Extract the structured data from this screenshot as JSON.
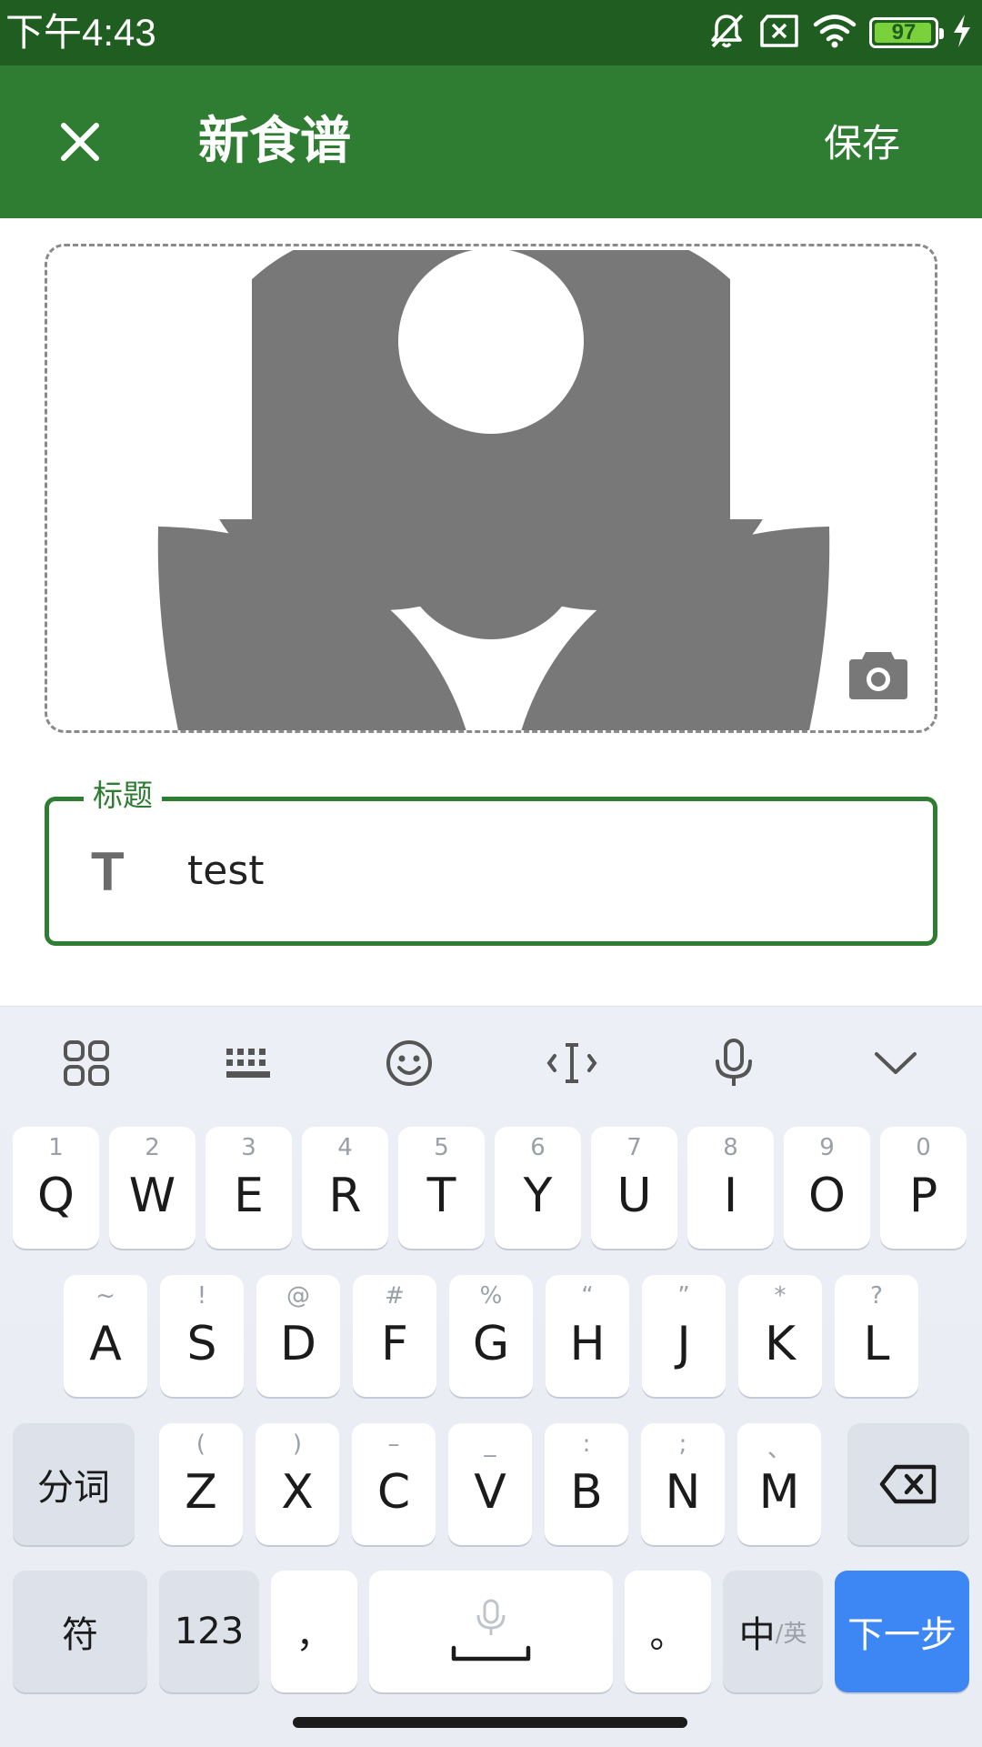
{
  "status_bar": {
    "time": "下午4:43",
    "battery": "97",
    "battery_level": 0.97,
    "icons": [
      "bell-off-icon",
      "sim-error-icon",
      "wifi-icon",
      "battery-icon",
      "charging-icon"
    ]
  },
  "app_bar": {
    "title": "新食谱",
    "save_label": "保存",
    "close_icon": "close-icon"
  },
  "image_picker": {
    "placeholder_icon": "flower-image-icon",
    "camera_icon": "camera-icon"
  },
  "title_field": {
    "label": "标题",
    "icon_text": "T",
    "value": "test"
  },
  "keyboard": {
    "toolbar": [
      "apps-grid-icon",
      "keyboard-icon",
      "emoji-icon",
      "cursor-move-icon",
      "microphone-icon",
      "chevron-down-icon"
    ],
    "row1": [
      {
        "hint": "1",
        "main": "Q"
      },
      {
        "hint": "2",
        "main": "W"
      },
      {
        "hint": "3",
        "main": "E"
      },
      {
        "hint": "4",
        "main": "R"
      },
      {
        "hint": "5",
        "main": "T"
      },
      {
        "hint": "6",
        "main": "Y"
      },
      {
        "hint": "7",
        "main": "U"
      },
      {
        "hint": "8",
        "main": "I"
      },
      {
        "hint": "9",
        "main": "O"
      },
      {
        "hint": "0",
        "main": "P"
      }
    ],
    "row2": [
      {
        "hint": "~",
        "main": "A"
      },
      {
        "hint": "!",
        "main": "S"
      },
      {
        "hint": "@",
        "main": "D"
      },
      {
        "hint": "#",
        "main": "F"
      },
      {
        "hint": "%",
        "main": "G"
      },
      {
        "hint": "“",
        "main": "H"
      },
      {
        "hint": "”",
        "main": "J"
      },
      {
        "hint": "*",
        "main": "K"
      },
      {
        "hint": "?",
        "main": "L"
      }
    ],
    "row3": [
      {
        "hint": "(",
        "main": "Z"
      },
      {
        "hint": ")",
        "main": "X"
      },
      {
        "hint": "–",
        "main": "C"
      },
      {
        "hint": "_",
        "main": "V"
      },
      {
        "hint": ":",
        "main": "B"
      },
      {
        "hint": ";",
        "main": "N"
      },
      {
        "hint": "、",
        "main": "M"
      }
    ],
    "segment_label": "分词",
    "symbols_label": "符",
    "numbers_label": "123",
    "comma_label": "，",
    "period_label": "。",
    "lang_label": "中",
    "lang_alt_label": "/英",
    "next_label": "下一步"
  },
  "colors": {
    "status_bar": "#1f5e20",
    "app_bar": "#2f7d32",
    "accent": "#2f7d32",
    "keyboard_bg": "#eceff6",
    "next_key": "#3d87f5"
  }
}
